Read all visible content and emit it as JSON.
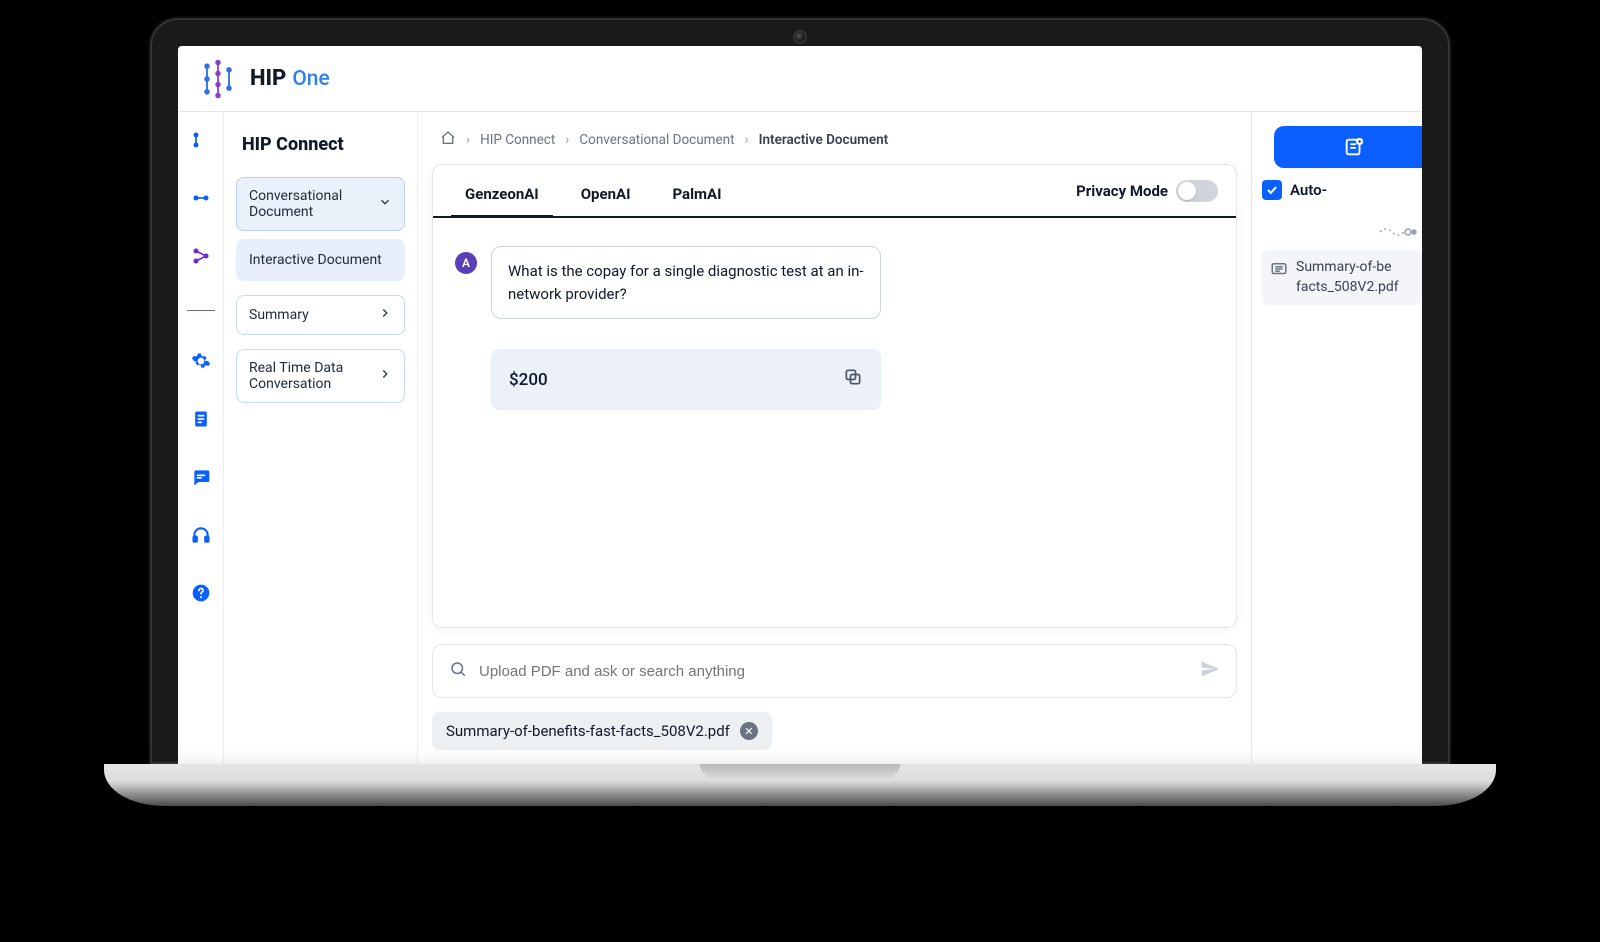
{
  "brand": {
    "name": "HIP",
    "suffix": "One"
  },
  "sidebar": {
    "title": "HIP Connect",
    "items": [
      {
        "label": "Conversational Document"
      },
      {
        "label": "Interactive Document"
      },
      {
        "label": "Summary"
      },
      {
        "label": "Real Time Data Conversation"
      }
    ]
  },
  "breadcrumbs": {
    "items": [
      {
        "label": "HIP Connect"
      },
      {
        "label": "Conversational Document"
      },
      {
        "label": "Interactive Document"
      }
    ]
  },
  "tabs": {
    "items": [
      {
        "label": "GenzeonAI"
      },
      {
        "label": "OpenAI"
      },
      {
        "label": "PalmAI"
      }
    ],
    "privacy_label": "Privacy Mode",
    "privacy_on": false
  },
  "chat": {
    "user_initial": "A",
    "question": "What is the copay for a single diagnostic test at an in-network provider?",
    "answer": "$200"
  },
  "input": {
    "placeholder": "Upload PDF and ask or search anything"
  },
  "file_chip": {
    "name": "Summary-of-benefits-fast-facts_508V2.pdf"
  },
  "right": {
    "auto_label": "Auto-",
    "auto_checked": true,
    "source_file": "Summary-of-be facts_508V2.pdf"
  },
  "colors": {
    "primary": "#0b5fff",
    "accent_purple": "#5b3fb8"
  }
}
